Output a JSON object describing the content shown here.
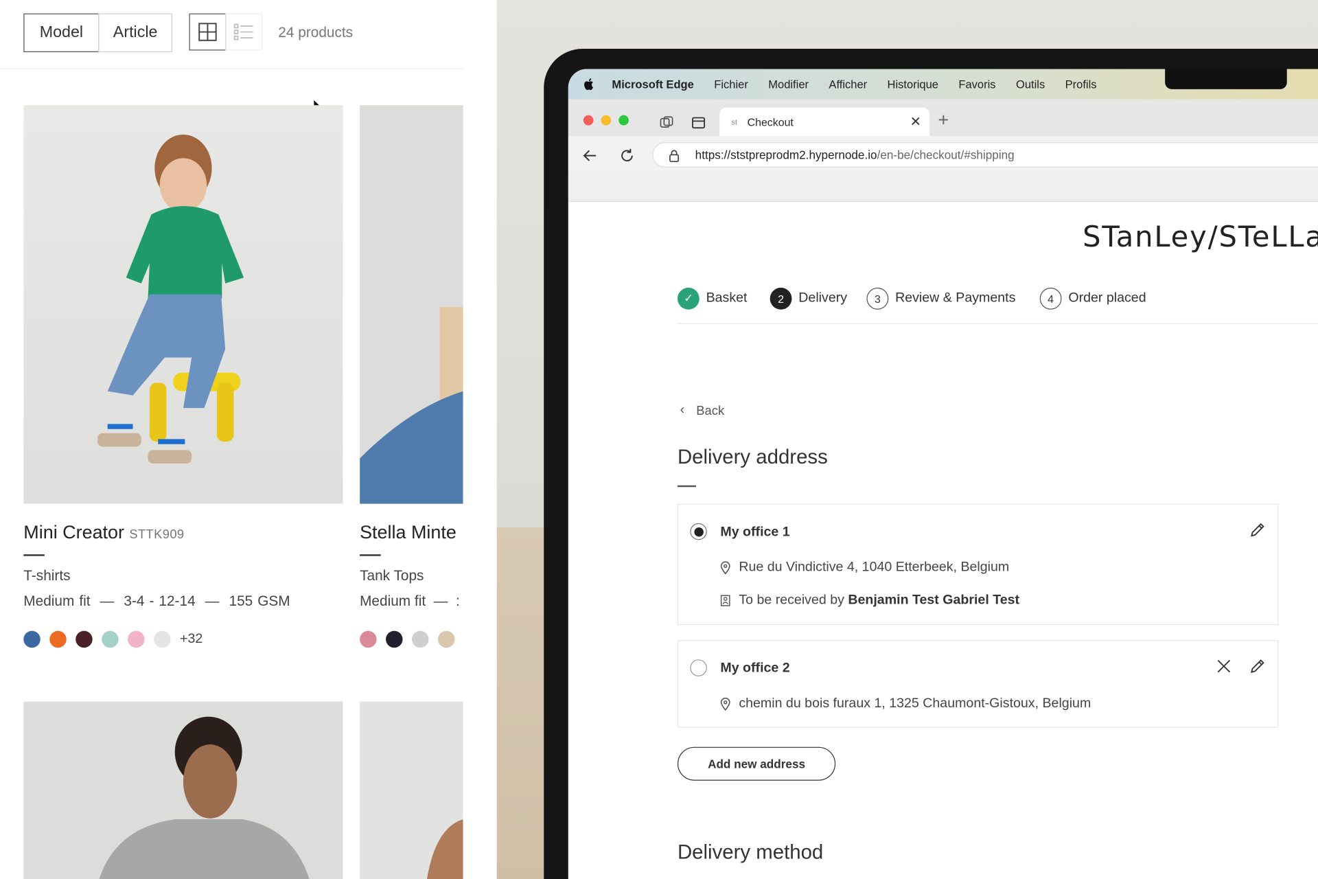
{
  "catalog": {
    "toggle": {
      "model": "Model",
      "article": "Article"
    },
    "view_modes": {
      "grid_icon": "grid-view-icon",
      "list_icon": "list-view-icon"
    },
    "count": "24 products",
    "products": [
      {
        "name": "Mini Creator",
        "code": "STTK909",
        "category": "T-shirts",
        "spec": "Medium fit  —  3-4 - 12-14  —  155 GSM",
        "swatches": [
          "#3d69a3",
          "#ec6a22",
          "#4a2029",
          "#a5d2c7",
          "#f2b3c8",
          "#e4e4e4"
        ],
        "more": "+32"
      },
      {
        "name": "Stella Minte",
        "category": "Tank Tops",
        "spec": "Medium fit  —  :",
        "swatches": [
          "#d98a97",
          "#20202e",
          "#cfcfcf",
          "#d9c8ad"
        ]
      }
    ]
  },
  "macos": {
    "menu": [
      "Microsoft Edge",
      "Fichier",
      "Modifier",
      "Afficher",
      "Historique",
      "Favoris",
      "Outils",
      "Profils"
    ]
  },
  "browser": {
    "tab_title": "Checkout",
    "tab_favicon": "st",
    "url_host": "https://ststpreprodm2.hypernode.io",
    "url_path": "/en-be/checkout/#shipping",
    "colors": {
      "close": "#f25f57",
      "minimize": "#f7bd2f",
      "maximize": "#2bc840"
    }
  },
  "checkout": {
    "logo": "STanLey/STeLLa",
    "steps": [
      {
        "num": "",
        "label": "Basket",
        "state": "done"
      },
      {
        "num": "2",
        "label": "Delivery",
        "state": "current"
      },
      {
        "num": "3",
        "label": "Review & Payments",
        "state": "todo"
      },
      {
        "num": "4",
        "label": "Order placed",
        "state": "todo"
      }
    ],
    "back": "Back",
    "delivery_address_title": "Delivery address",
    "addresses": [
      {
        "name": "My office 1",
        "street": "Rue du Vindictive 4, 1040 Etterbeek, Belgium",
        "receiver_prefix": "To be received by ",
        "receiver": "Benjamin Test Gabriel Test",
        "selected": true
      },
      {
        "name": "My office 2",
        "street": "chemin du bois furaux 1, 1325 Chaumont-Gistoux, Belgium",
        "selected": false
      }
    ],
    "add_address": "Add new address",
    "delivery_method_title": "Delivery method",
    "accent": "#2aa37a"
  }
}
